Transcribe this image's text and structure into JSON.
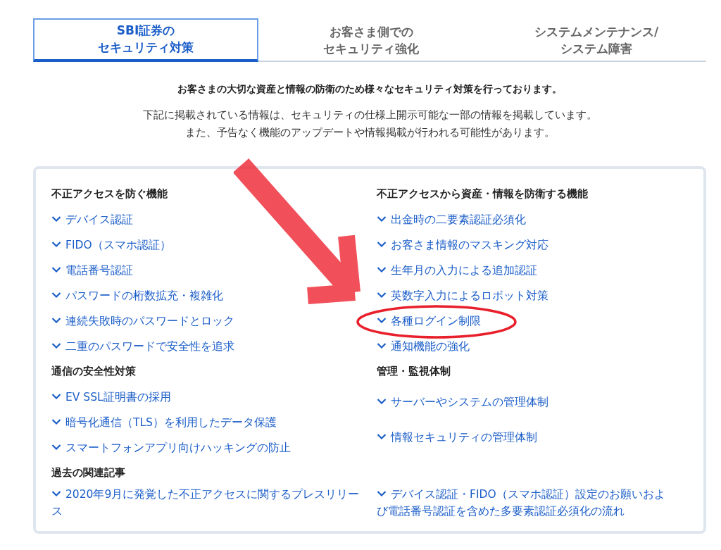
{
  "tabs": [
    {
      "lines": [
        "SBI証券の",
        "セキュリティ対策"
      ],
      "selected": true
    },
    {
      "lines": [
        "お客さま側での",
        "セキュリティ強化"
      ],
      "selected": false
    },
    {
      "lines": [
        "システムメンテナンス/",
        "システム障害"
      ],
      "selected": false
    }
  ],
  "lead": "お客さまの大切な資産と情報の防衛のため様々なセキュリティ対策を行っております。",
  "notes": [
    "下記に掲載されている情報は、セキュリティの仕様上開示可能な一部の情報を掲載しています。",
    "また、予告なく機能のアップデートや情報掲載が行われる可能性があります。"
  ],
  "blocks": [
    {
      "left": {
        "heading": "不正アクセスを防ぐ機能",
        "links": [
          {
            "label": "デバイス認証",
            "circled": false
          },
          {
            "label": "FIDO（スマホ認証）",
            "circled": false
          },
          {
            "label": "電話番号認証",
            "circled": false
          },
          {
            "label": "パスワードの桁数拡充・複雑化",
            "circled": false
          },
          {
            "label": "連続失敗時のパスワードとロック",
            "circled": false
          },
          {
            "label": "二重のパスワードで安全性を追求",
            "circled": false
          }
        ]
      },
      "right": {
        "heading": "不正アクセスから資産・情報を防衛する機能",
        "links": [
          {
            "label": "出金時の二要素認証必須化",
            "circled": false
          },
          {
            "label": "お客さま情報のマスキング対応",
            "circled": false
          },
          {
            "label": "生年月の入力による追加認証",
            "circled": false
          },
          {
            "label": "英数字入力によるロボット対策",
            "circled": false
          },
          {
            "label": "各種ログイン制限",
            "circled": true
          },
          {
            "label": "通知機能の強化",
            "circled": false
          }
        ]
      }
    },
    {
      "left": {
        "heading": "通信の安全性対策",
        "links": [
          {
            "label": "EV SSL証明書の採用",
            "circled": false
          },
          {
            "label": "暗号化通信（TLS）を利用したデータ保護",
            "circled": false
          },
          {
            "label": "スマートフォンアプリ向けハッキングの防止",
            "circled": false
          }
        ]
      },
      "right": {
        "heading": "管理・監視体制",
        "links": [
          {
            "label": "サーバーやシステムの管理体制",
            "circled": false
          },
          {
            "label": "情報セキュリティの管理体制",
            "circled": false
          }
        ]
      }
    },
    {
      "left": {
        "heading": "過去の関連記事",
        "links": [
          {
            "label": "2020年9月に発覚した不正アクセスに関するプレスリリース",
            "circled": false
          }
        ]
      },
      "right": {
        "links": [
          {
            "label": "デバイス認証・FIDO（スマホ認証）設定のお願いおよび電話番号認証を含めた多要素認証必須化の流れ",
            "circled": false
          }
        ]
      }
    }
  ],
  "annotations": [
    {
      "kind": "arrow"
    }
  ]
}
